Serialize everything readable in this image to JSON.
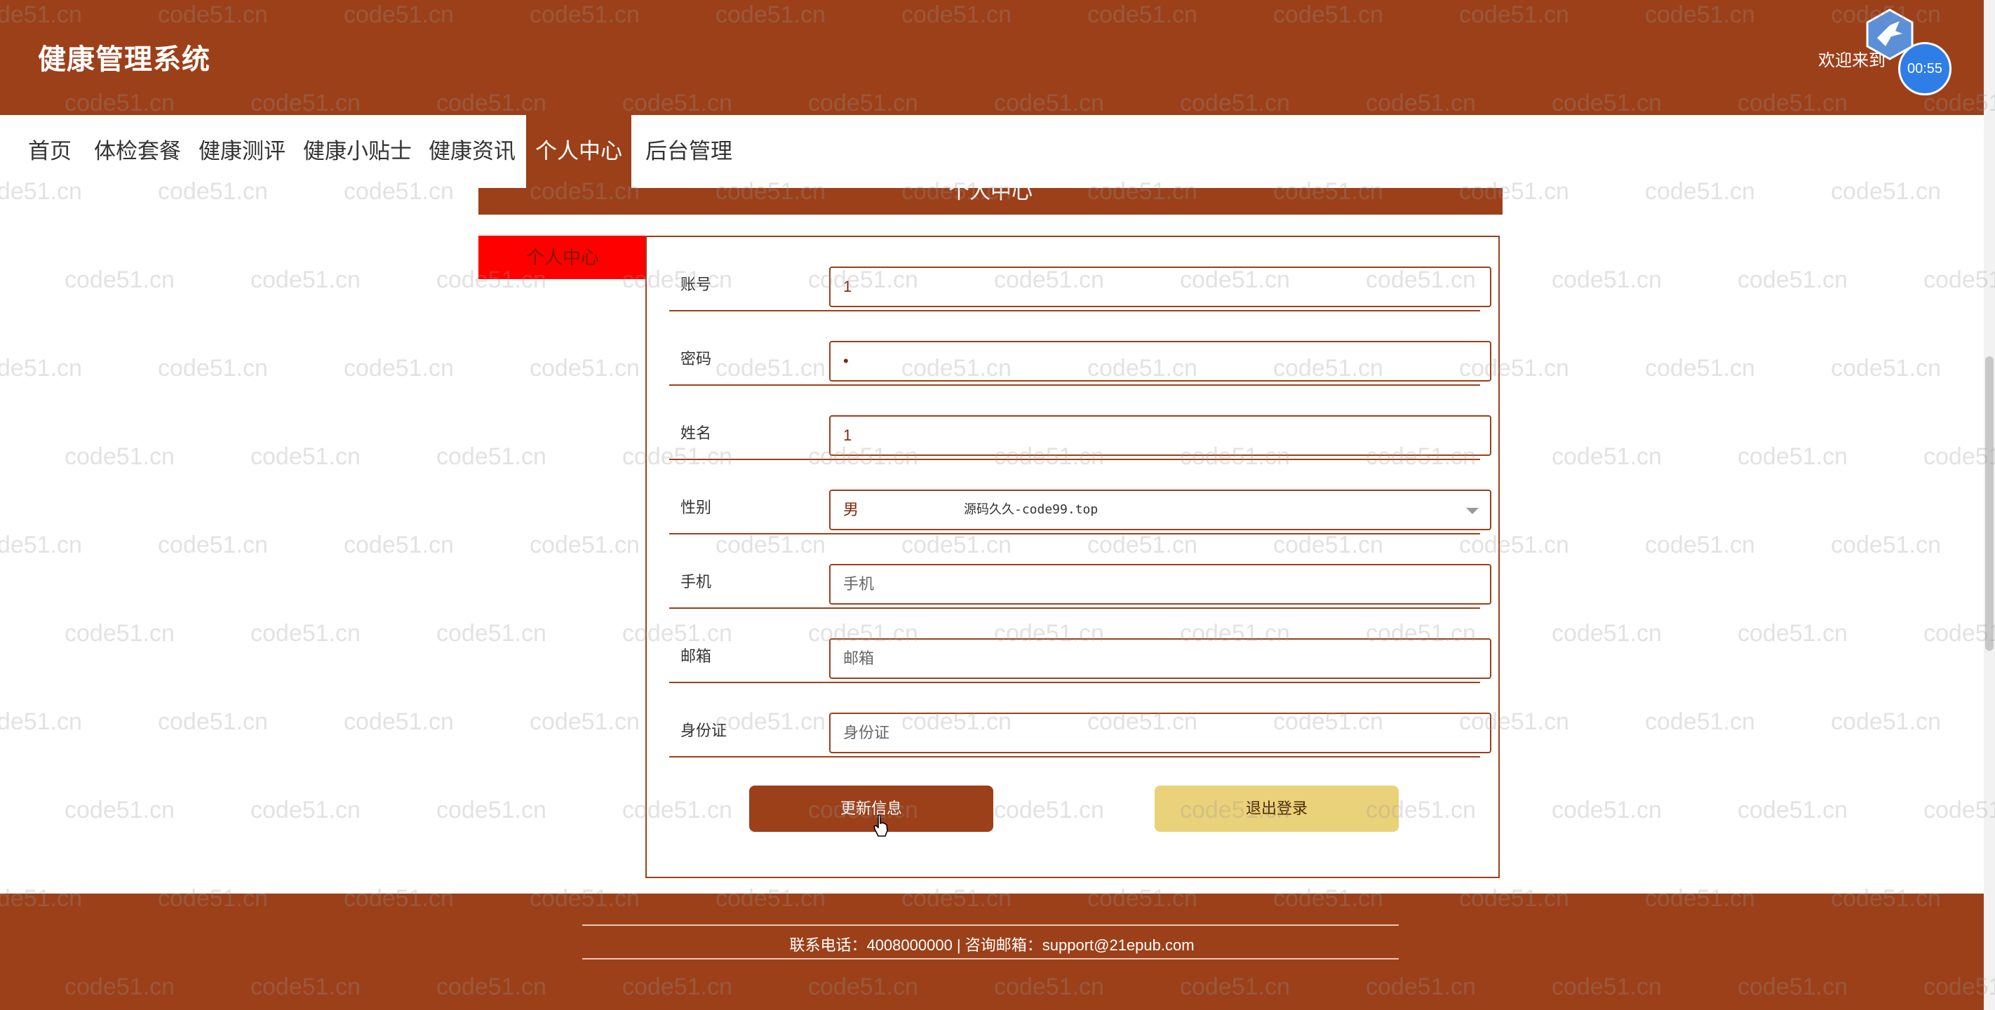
{
  "header": {
    "title": "健康管理系统",
    "welcome": "欢迎来到"
  },
  "nav": {
    "items": [
      {
        "label": "首页"
      },
      {
        "label": "体检套餐"
      },
      {
        "label": "健康测评"
      },
      {
        "label": "健康小贴士"
      },
      {
        "label": "健康资讯"
      },
      {
        "label": "个人中心"
      },
      {
        "label": "后台管理"
      }
    ],
    "active": "个人中心"
  },
  "panel": {
    "title": "个人中心"
  },
  "side_menu": {
    "label": "个人中心"
  },
  "form": {
    "fields": [
      {
        "label": "账号",
        "value": "1",
        "placeholder": ""
      },
      {
        "label": "密码",
        "value": "•",
        "placeholder": ""
      },
      {
        "label": "姓名",
        "value": "1",
        "placeholder": ""
      },
      {
        "label": "性别",
        "value": "男",
        "overlay": "源码久久-code99.top"
      },
      {
        "label": "手机",
        "value": "",
        "placeholder": "手机"
      },
      {
        "label": "邮箱",
        "value": "",
        "placeholder": "邮箱"
      },
      {
        "label": "身份证",
        "value": "",
        "placeholder": "身份证"
      }
    ],
    "update_button": "更新信息",
    "logout_button": "退出登录"
  },
  "footer": {
    "contact": "联系电话：4008000000 | 咨询邮箱：support@21epub.com"
  },
  "timer": {
    "value": "00:55"
  },
  "watermark": {
    "text": "code51.cn"
  },
  "colors": {
    "brand": "#9c401a",
    "accent_red": "#ff0000",
    "logout_bg": "#ead27a",
    "timer_blue": "#2f7ee8"
  }
}
